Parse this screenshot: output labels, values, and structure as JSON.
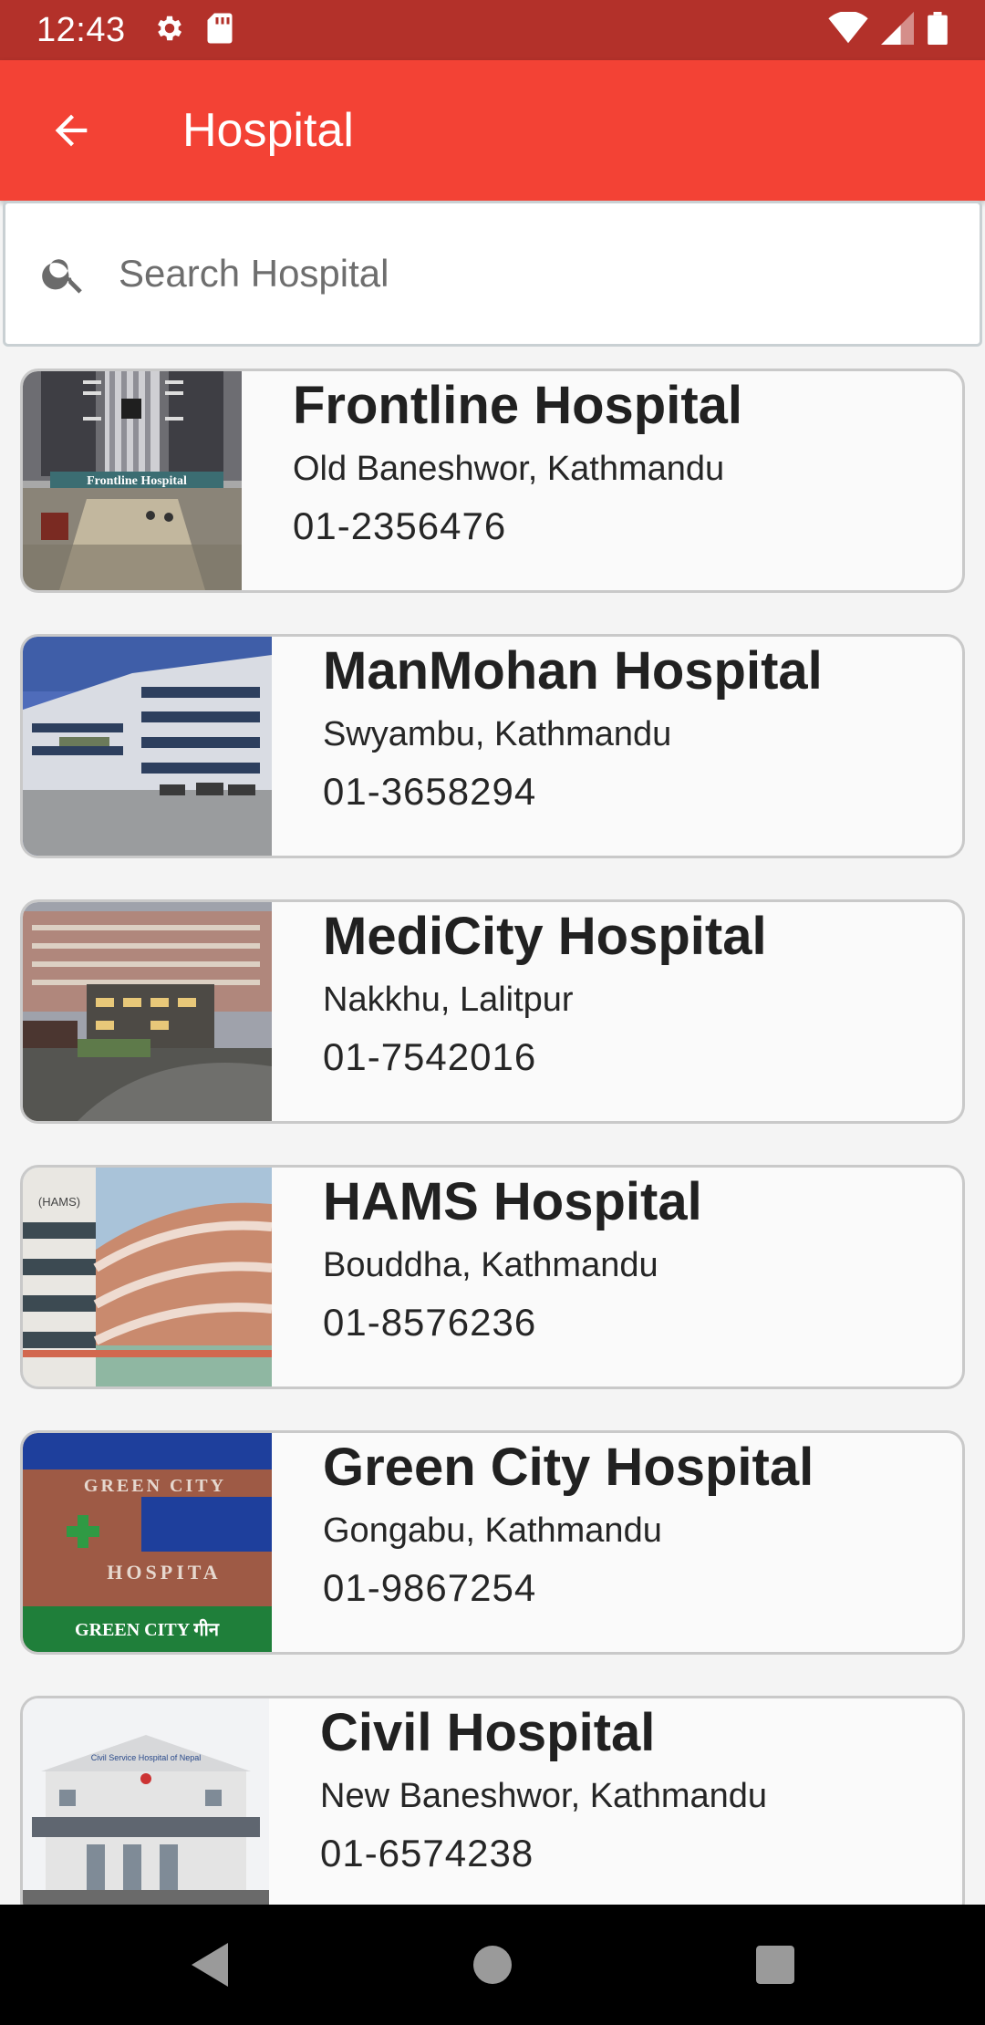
{
  "status_bar": {
    "time": "12:43",
    "icons": [
      "gear-icon",
      "sd-card-icon",
      "wifi-icon",
      "signal-icon",
      "battery-icon"
    ]
  },
  "app_bar": {
    "title": "Hospital",
    "back_icon": "arrow-back-icon",
    "color": "#f34235",
    "status_color": "#b3312a"
  },
  "search": {
    "placeholder": "Search Hospital",
    "value": ""
  },
  "hospitals": [
    {
      "name": "Frontline Hospital",
      "address": "Old Baneshwor, Kathmandu",
      "phone": "01-2356476",
      "sign": "Frontline Hospital"
    },
    {
      "name": "ManMohan Hospital",
      "address": "Swyambu, Kathmandu",
      "phone": "01-3658294"
    },
    {
      "name": "MediCity Hospital",
      "address": "Nakkhu, Lalitpur",
      "phone": "01-7542016"
    },
    {
      "name": "HAMS Hospital",
      "address": "Bouddha, Kathmandu",
      "phone": "01-8576236",
      "sign": "(HAMS)"
    },
    {
      "name": "Green City Hospital",
      "address": "Gongabu, Kathmandu",
      "phone": "01-9867254",
      "sign_top": "GREEN CITY",
      "sign_bottom": "HOSPITA",
      "sign_banner": "GREEN CITY गीन"
    },
    {
      "name": "Civil Hospital",
      "address": "New Baneshwor, Kathmandu",
      "phone": "01-6574238",
      "sign": "Civil Service Hospital of Nepal"
    }
  ],
  "nav_bar": {
    "buttons": [
      "back-triangle-icon",
      "home-circle-icon",
      "recents-square-icon"
    ]
  }
}
